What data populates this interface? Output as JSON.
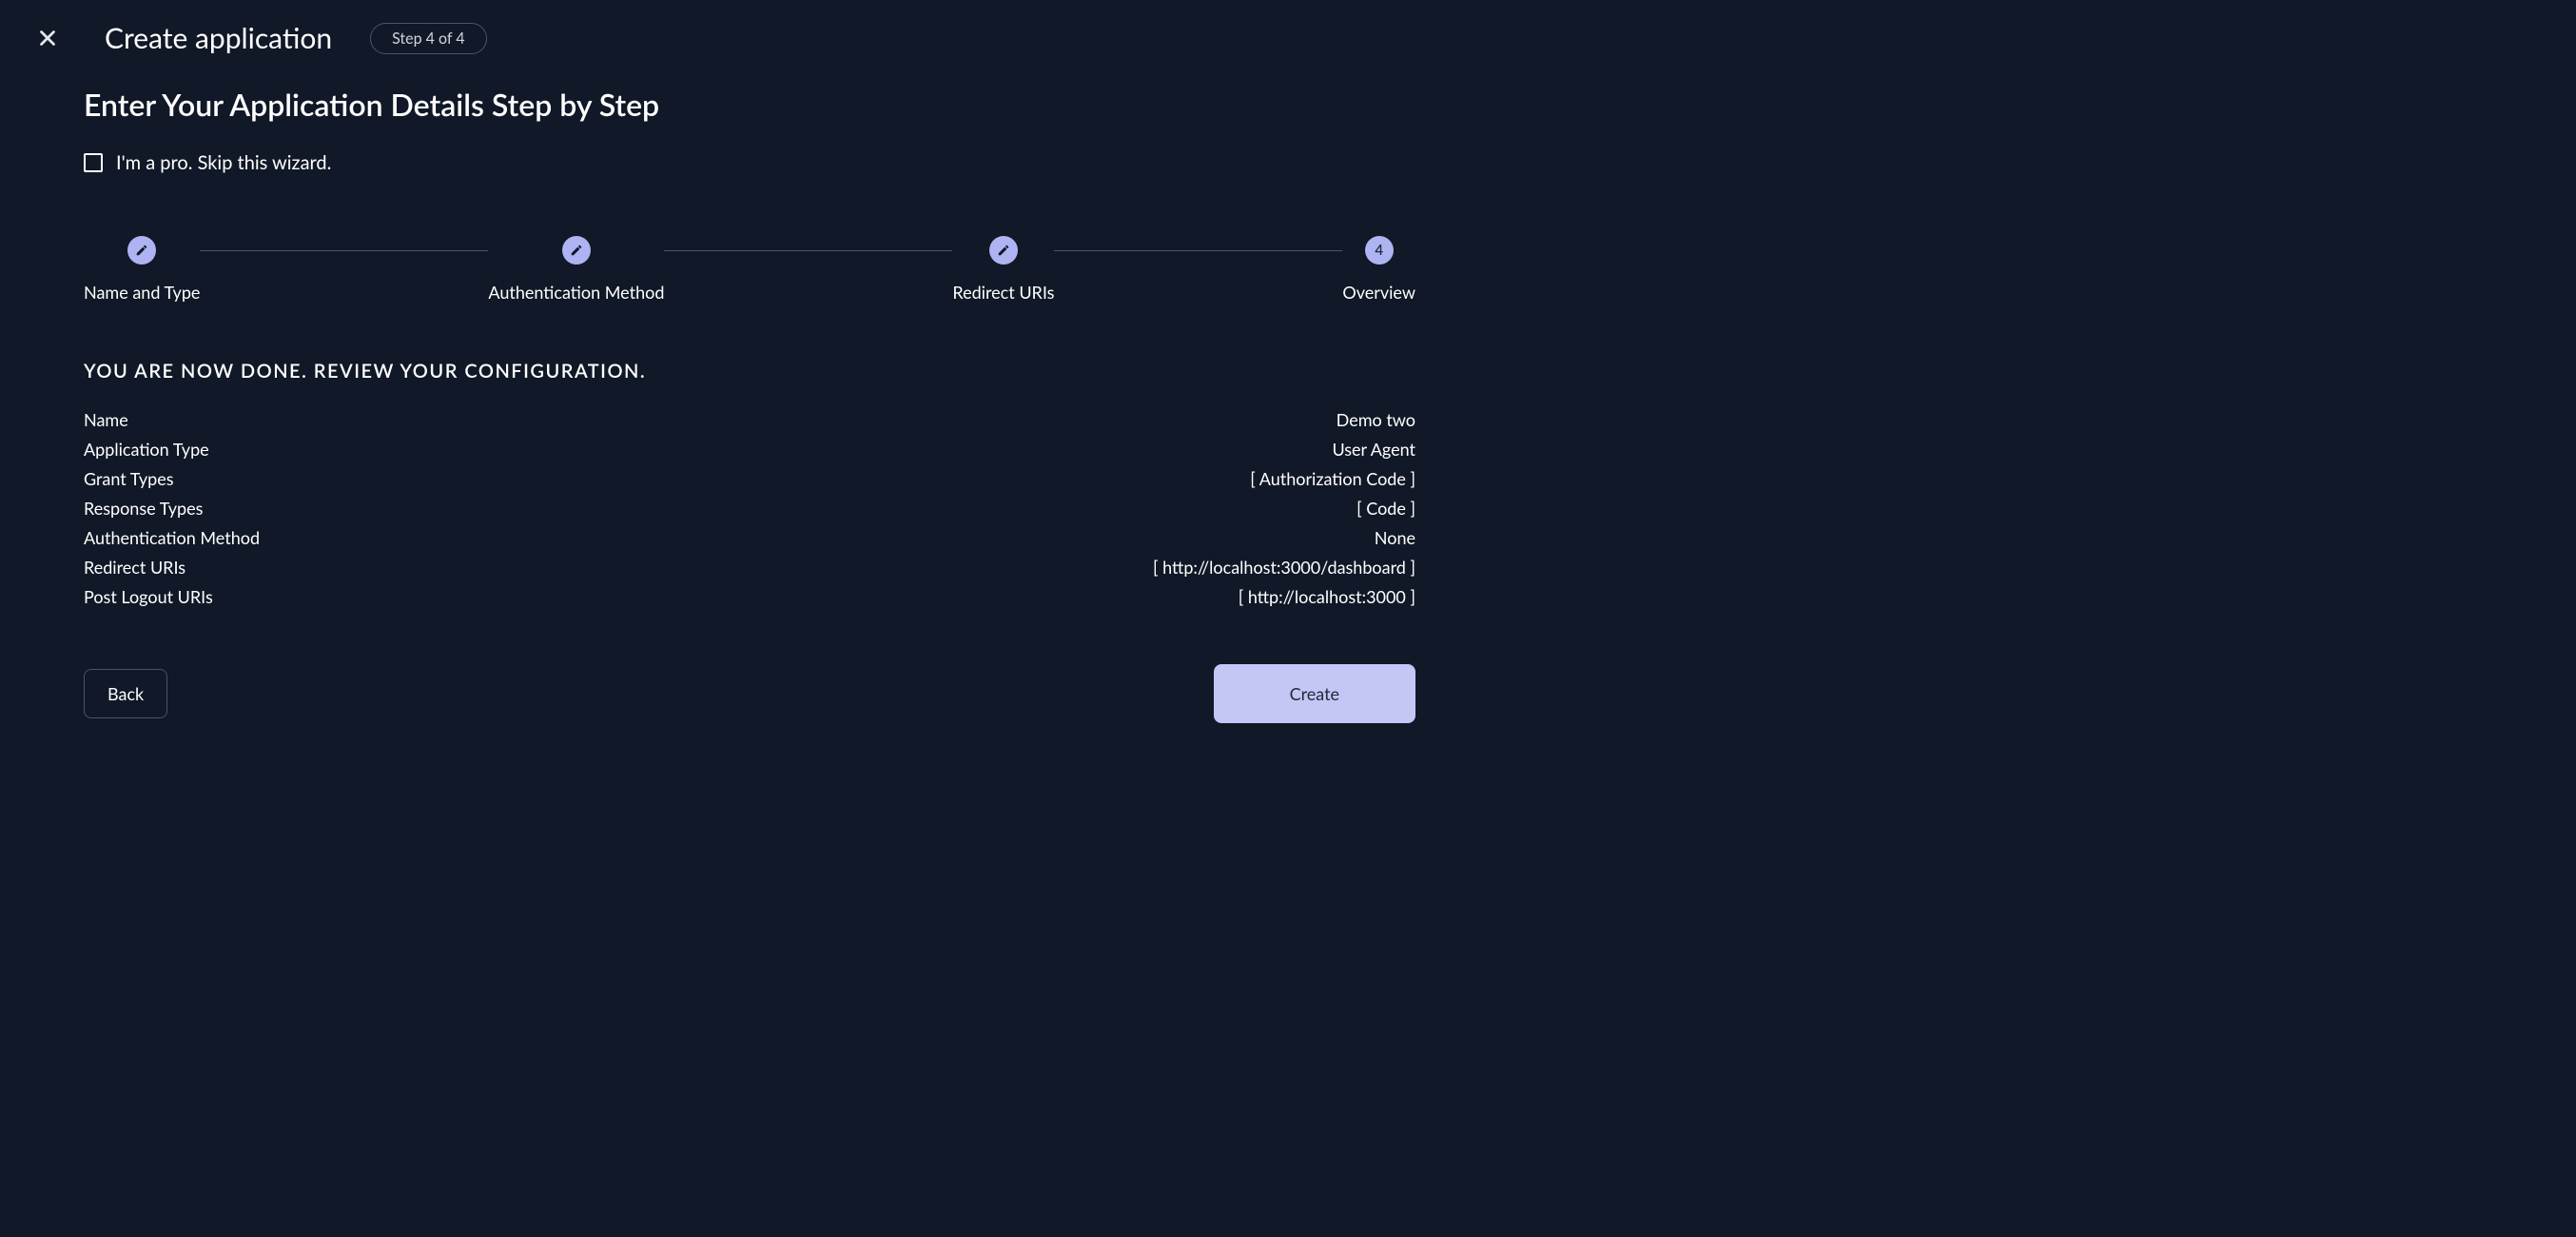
{
  "header": {
    "title": "Create application",
    "step_badge": "Step 4 of 4"
  },
  "wizard": {
    "heading": "Enter Your Application Details Step by Step",
    "skip_label": "I'm a pro. Skip this wizard."
  },
  "stepper": {
    "steps": [
      {
        "label": "Name and Type",
        "state": "done"
      },
      {
        "label": "Authentication Method",
        "state": "done"
      },
      {
        "label": "Redirect URIs",
        "state": "done"
      },
      {
        "label": "Overview",
        "state": "current",
        "number": "4"
      }
    ]
  },
  "review": {
    "heading": "You are now done. Review your configuration.",
    "rows": [
      {
        "label": "Name",
        "value": "Demo two"
      },
      {
        "label": "Application Type",
        "value": "User Agent"
      },
      {
        "label": "Grant Types",
        "value": "[ Authorization Code ]"
      },
      {
        "label": "Response Types",
        "value": "[ Code ]"
      },
      {
        "label": "Authentication Method",
        "value": "None"
      },
      {
        "label": "Redirect URIs",
        "value": "[ http://localhost:3000/dashboard ]"
      },
      {
        "label": "Post Logout URIs",
        "value": "[ http://localhost:3000 ]"
      }
    ]
  },
  "actions": {
    "back": "Back",
    "create": "Create"
  }
}
